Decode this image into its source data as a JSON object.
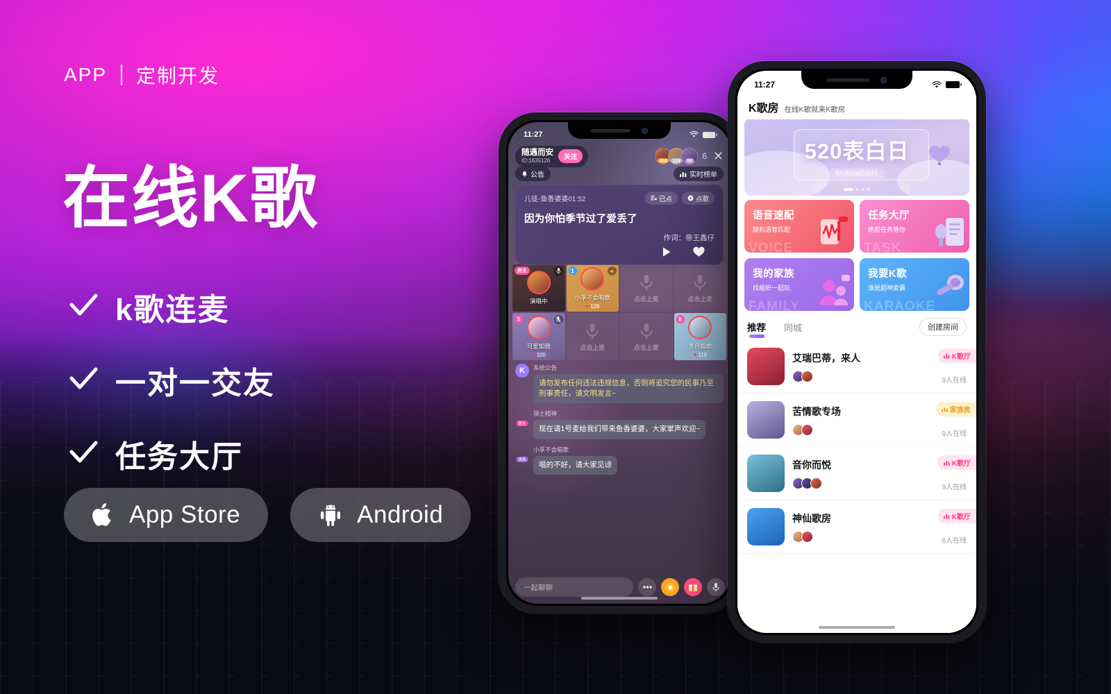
{
  "background": {
    "colors": {
      "magenta": "#ff2ad4",
      "purple": "#b31bff",
      "blue": "#1f6dff",
      "cyan": "#12b6ff",
      "dark": "#0a0b12"
    }
  },
  "left": {
    "kicker_app": "APP",
    "kicker_text": "定制开发",
    "headline": "在线K歌",
    "features": [
      {
        "label": "k歌连麦",
        "icon": "check-icon"
      },
      {
        "label": "一对一交友",
        "icon": "check-icon"
      },
      {
        "label": "任务大厅",
        "icon": "check-icon"
      }
    ],
    "stores": [
      {
        "label": "App Store",
        "icon": "apple-icon"
      },
      {
        "label": "Android",
        "icon": "android-icon"
      }
    ]
  },
  "phone1": {
    "status": {
      "time": "11:27",
      "wifi": "wifi-icon",
      "battery": "battery-icon"
    },
    "header": {
      "user_name": "随遇而安",
      "user_id": "ID:1635126",
      "follow_label": "关注",
      "viewers": [
        {
          "rank": "459",
          "color": "#f0a030"
        },
        {
          "rank": "124",
          "color": "#b9bcc7"
        },
        {
          "rank": "89",
          "color": "#c08bd8"
        }
      ],
      "viewer_count": "6",
      "close_label": "✕"
    },
    "notice_label": "公告",
    "rank_label": "实时榜单",
    "song": {
      "title": "儿徒-鱼香婆婆01:52",
      "queued_label": "已点",
      "order_label": "点歌",
      "lyric": "因为你怕季节过了爱丢了",
      "writer": "作词：帝王鑫仔"
    },
    "seats": [
      {
        "state": "occupied",
        "tag": "房主",
        "name": "演唱中",
        "likes": "",
        "mic": "mic-on-icon"
      },
      {
        "state": "occupied",
        "num": "1",
        "name": "小孚不会唱歌",
        "likes": "126",
        "mic": "speaker-icon"
      },
      {
        "state": "empty",
        "label": "点击上麦"
      },
      {
        "state": "empty",
        "label": "点击上麦"
      },
      {
        "state": "occupied",
        "num": "5",
        "name": "可爱如我",
        "likes": "100",
        "mic": "mic-off-icon"
      },
      {
        "state": "empty",
        "label": "点击上麦"
      },
      {
        "state": "empty",
        "label": "点击上麦"
      },
      {
        "state": "occupied",
        "num": "8",
        "name": "岁月如歌",
        "likes": "118"
      }
    ],
    "chat": [
      {
        "avatar": "K",
        "name": "系统公告",
        "text": "请勿发布任何违法违规信息，否则将追究您的民事乃至刑事责任，请文明发言~",
        "type": "system"
      },
      {
        "avatar": "",
        "name": "骑士精神",
        "badge": "房主",
        "text": "现在请1号麦给我们带来鱼香婆婆，大家掌声欢迎~",
        "type": "user"
      },
      {
        "avatar": "",
        "name": "小孚不会唱歌",
        "badge": "贵族",
        "text": "唱的不好，请大家见谅",
        "type": "user"
      }
    ],
    "input_placeholder": "一起聊聊",
    "actions": [
      {
        "icon": "more-icon"
      },
      {
        "icon": "emoji-icon"
      },
      {
        "icon": "gift-icon"
      },
      {
        "icon": "mic-icon"
      }
    ]
  },
  "phone2": {
    "status": {
      "time": "11:27"
    },
    "title": "K歌房",
    "subtitle": "在线K歌就来K歌房",
    "banner": {
      "main": "520",
      "main_suffix": "表白日",
      "sub": "限时表白抽奖送好礼",
      "dots": 4,
      "active_dot": 0
    },
    "entry_cards": [
      {
        "title": "语音速配",
        "sub": "随机语音匹配",
        "ghost": "VOICE",
        "color": "#f97a7a",
        "color2": "#f2566b"
      },
      {
        "title": "任务大厅",
        "sub": "绝密任务等你",
        "ghost": "TASK",
        "color": "#f878c0",
        "color2": "#ef5fae"
      },
      {
        "title": "我的家族",
        "sub": "找组织一起玩",
        "ghost": "FAMILY",
        "color": "#b07ef0",
        "color2": "#9b6ae8"
      },
      {
        "title": "我要K歌",
        "sub": "谁是超神麦霸",
        "ghost": "KARAOKE",
        "color": "#4fa8f5",
        "color2": "#3f93ef"
      }
    ],
    "tabs": [
      {
        "label": "推荐",
        "active": true
      },
      {
        "label": "同城",
        "active": false
      }
    ],
    "create_room_label": "创建房间",
    "rooms": [
      {
        "name": "艾瑞巴蒂，来人",
        "badge": "K歌厅",
        "badge_type": "k",
        "online": "9人在线",
        "thumb": "#c23a4a"
      },
      {
        "name": "苦情歌专场",
        "badge": "家族房",
        "badge_type": "f",
        "online": "9人在线",
        "thumb": "#8e86c4"
      },
      {
        "name": "音你而悦",
        "badge": "K歌厅",
        "badge_type": "k",
        "online": "9人在线",
        "thumb": "#4b8fa8"
      },
      {
        "name": "神仙歌房",
        "badge": "K歌厅",
        "badge_type": "k",
        "online": "6人在线",
        "thumb": "#2f7fd6"
      }
    ]
  }
}
